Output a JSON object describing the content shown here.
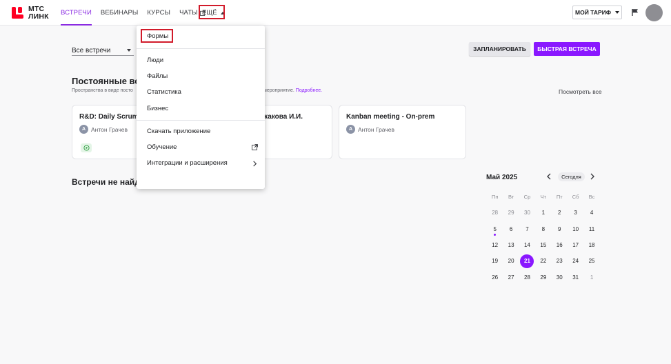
{
  "logo": {
    "line1": "МТС",
    "line2": "ЛИНК"
  },
  "nav": {
    "items": [
      {
        "label": "Встречи",
        "active": true
      },
      {
        "label": "Вебинары",
        "active": false
      },
      {
        "label": "Курсы",
        "active": false
      },
      {
        "label": "Чаты",
        "active": false,
        "external": true
      }
    ],
    "more_label": "Ещё"
  },
  "header_right": {
    "tariff_label": "МОЙ ТАРИФ"
  },
  "filter": {
    "value": "Все встречи"
  },
  "actions": {
    "plan_label": "ЗАПЛАНИРОВАТЬ",
    "quick_label": "БЫСТРАЯ ВСТРЕЧА"
  },
  "permanent": {
    "title": "Постоянные встр",
    "desc_start": "Пространства в виде посто",
    "desc_end": "мероприятие.",
    "desc_link": "Подробнее.",
    "see_all": "Посмотреть все"
  },
  "cards": [
    {
      "title": "R&D: Daily Scrum - I",
      "owner": "Антон Грачев",
      "avatar": "А"
    },
    {
      "title": "ожакова И.И.",
      "owner": "",
      "avatar": ""
    },
    {
      "title": "Kanban meeting - On-prem",
      "owner": "Антон Грачев",
      "avatar": "А"
    }
  ],
  "empty": {
    "title": "Встречи не найде"
  },
  "calendar": {
    "month": "Май 2025",
    "today_label": "Сегодня",
    "weekdays": [
      "Пн",
      "Вт",
      "Ср",
      "Чт",
      "Пт",
      "Сб",
      "Вс"
    ],
    "weeks": [
      [
        "28",
        "29",
        "30",
        "1",
        "2",
        "3",
        "4"
      ],
      [
        "5",
        "6",
        "7",
        "8",
        "9",
        "10",
        "11"
      ],
      [
        "12",
        "13",
        "14",
        "15",
        "16",
        "17",
        "18"
      ],
      [
        "19",
        "20",
        "21",
        "22",
        "23",
        "24",
        "25"
      ],
      [
        "26",
        "27",
        "28",
        "29",
        "30",
        "31",
        "1"
      ]
    ],
    "selected": "21",
    "event_day": "5",
    "accent": "#8a18ff"
  },
  "menu": {
    "items": [
      "Формы",
      "Люди",
      "Файлы",
      "Статистика",
      "Бизнес",
      "Скачать приложение",
      "Обучение",
      "Интеграции и расширения"
    ]
  },
  "colors": {
    "brand_red": "#ff0023",
    "accent_purple": "#8a18ff",
    "highlight_box": "#d11a2a"
  }
}
